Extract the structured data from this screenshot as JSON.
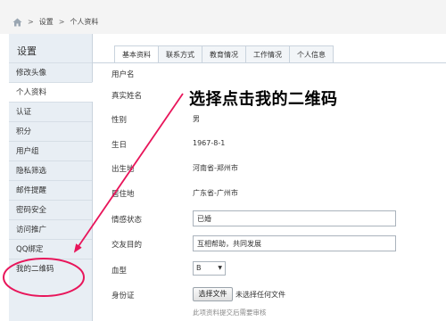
{
  "breadcrumb": {
    "separator": ">",
    "items": [
      "设置",
      "个人资料"
    ]
  },
  "sidebar": {
    "title": "设置",
    "items": [
      {
        "label": "修改头像"
      },
      {
        "label": "个人资料"
      },
      {
        "label": "认证"
      },
      {
        "label": "积分"
      },
      {
        "label": "用户组"
      },
      {
        "label": "隐私筛选"
      },
      {
        "label": "邮件提醒"
      },
      {
        "label": "密码安全"
      },
      {
        "label": "访问推广"
      },
      {
        "label": "QQ绑定"
      },
      {
        "label": "我的二维码"
      }
    ],
    "active_index": 1
  },
  "tabs": [
    {
      "label": "基本资料"
    },
    {
      "label": "联系方式"
    },
    {
      "label": "教育情况"
    },
    {
      "label": "工作情况"
    },
    {
      "label": "个人信息"
    }
  ],
  "form": {
    "username": {
      "label": "用户名",
      "value": ""
    },
    "realname": {
      "label": "真实姓名",
      "value": ""
    },
    "gender": {
      "label": "性别",
      "value": "男"
    },
    "birthday": {
      "label": "生日",
      "value": "1967-8-1"
    },
    "birthplace": {
      "label": "出生地",
      "value": "河南省-郑州市"
    },
    "residence": {
      "label": "居住地",
      "value": "广东省-广州市"
    },
    "marital": {
      "label": "情感状态",
      "value": "已婚"
    },
    "purpose": {
      "label": "交友目的",
      "value": "互相帮助，共同发展"
    },
    "blood": {
      "label": "血型",
      "value": "B"
    },
    "idcard": {
      "label": "身份证",
      "button": "选择文件",
      "status": "未选择任何文件",
      "hint": "此项资料提交后需要审核"
    }
  },
  "annotation": {
    "text": "选择点击我的二维码",
    "color": "#e8155a"
  }
}
